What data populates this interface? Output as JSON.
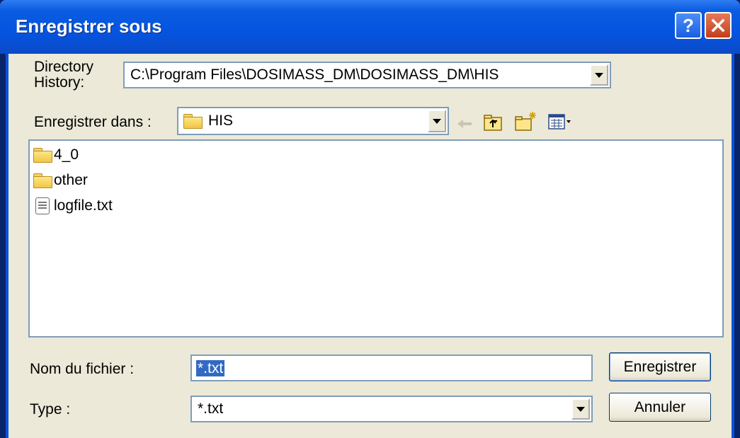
{
  "window": {
    "title": "Enregistrer sous"
  },
  "colors": {
    "title_bar": "#0554e0",
    "dialog_bg": "#ece9d8",
    "selection": "#316ac5",
    "close": "#c33e1c"
  },
  "directory_history": {
    "label_line1": "Directory",
    "label_line2": "History:",
    "value": "C:\\Program Files\\DOSIMASS_DM\\DOSIMASS_DM\\HIS"
  },
  "save_in": {
    "label": "Enregistrer dans :",
    "value": "HIS"
  },
  "toolbar": {
    "icons": [
      "back-arrow-icon",
      "up-folder-icon",
      "new-folder-icon",
      "view-menu-icon"
    ]
  },
  "files": [
    {
      "name": "4_0",
      "type": "folder"
    },
    {
      "name": "other",
      "type": "folder"
    },
    {
      "name": "logfile.txt",
      "type": "file"
    }
  ],
  "filename": {
    "label": "Nom du fichier :",
    "value": "*.txt"
  },
  "filetype": {
    "label": "Type :",
    "value": "*.txt"
  },
  "buttons": {
    "save": "Enregistrer",
    "cancel": "Annuler"
  }
}
